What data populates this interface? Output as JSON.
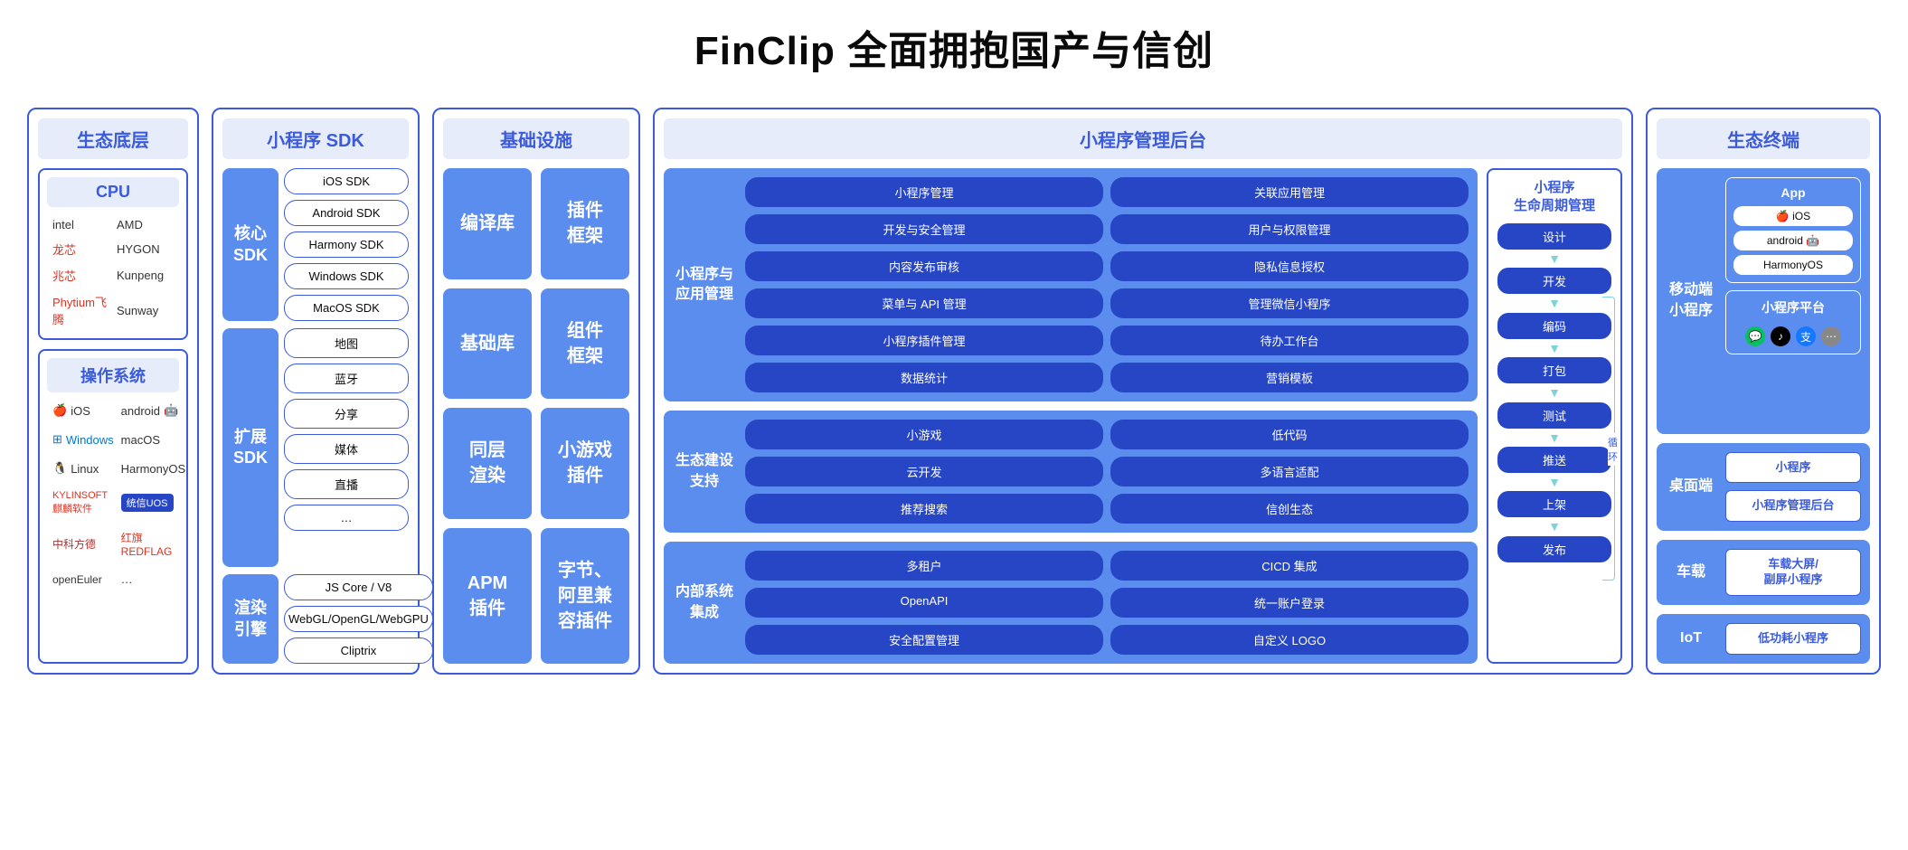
{
  "title": "FinClip 全面拥抱国产与信创",
  "col1": {
    "header": "生态底层",
    "cpu": {
      "title": "CPU",
      "items": [
        "intel",
        "AMD",
        "龙芯",
        "HYGON",
        "兆芯",
        "Kunpeng",
        "Phytium飞腾",
        "Sunway"
      ]
    },
    "os": {
      "title": "操作系统",
      "items": [
        "iOS",
        "android",
        "Windows",
        "macOS",
        "Linux",
        "HarmonyOS",
        "KYLINSOFT 麒麟软件",
        "统信UOS",
        "中科方德",
        "红旗 REDFLAG",
        "openEuler",
        "…"
      ]
    }
  },
  "col2": {
    "header": "小程序 SDK",
    "core": {
      "label": "核心\nSDK",
      "items": [
        "iOS SDK",
        "Android SDK",
        "Harmony SDK",
        "Windows SDK",
        "MacOS SDK"
      ]
    },
    "ext": {
      "label": "扩展\nSDK",
      "items": [
        "地图",
        "蓝牙",
        "分享",
        "媒体",
        "直播",
        "…"
      ]
    },
    "render": {
      "label": "渲染\n引擎",
      "items": [
        "JS Core / V8",
        "WebGL/OpenGL/WebGPU",
        "Cliptrix"
      ]
    }
  },
  "col3": {
    "header": "基础设施",
    "boxes": [
      "编译库",
      "插件\n框架",
      "基础库",
      "组件\n框架",
      "同层\n渲染",
      "小游戏\n插件",
      "APM\n插件",
      "字节、\n阿里兼\n容插件"
    ]
  },
  "col4": {
    "header": "小程序管理后台",
    "s1": {
      "label": "小程序与\n应用管理",
      "items": [
        "小程序管理",
        "关联应用管理",
        "开发与安全管理",
        "用户与权限管理",
        "内容发布审核",
        "隐私信息授权",
        "菜单与 API 管理",
        "管理微信小程序",
        "小程序插件管理",
        "待办工作台",
        "数据统计",
        "营销模板"
      ]
    },
    "s2": {
      "label": "生态建设\n支持",
      "items": [
        "小游戏",
        "低代码",
        "云开发",
        "多语言适配",
        "推荐搜索",
        "信创生态"
      ]
    },
    "s3": {
      "label": "内部系统\n集成",
      "items": [
        "多租户",
        "CICD 集成",
        "OpenAPI",
        "统一账户登录",
        "安全配置管理",
        "自定义 LOGO"
      ]
    },
    "lifecycle": {
      "title": "小程序\n生命周期管理",
      "steps": [
        "设计",
        "开发",
        "编码",
        "打包",
        "测试",
        "推送",
        "上架",
        "发布"
      ],
      "loop": "循\n环"
    }
  },
  "col5": {
    "header": "生态终端",
    "mobile": {
      "label": "移动端\n小程序",
      "app_title": "App",
      "apps": [
        "🍎 iOS",
        "android 🤖",
        "HarmonyOS"
      ],
      "platform_title": "小程序平台"
    },
    "desktop": {
      "label": "桌面端",
      "items": [
        "小程序",
        "小程序管理后台"
      ]
    },
    "vehicle": {
      "label": "车载",
      "items": [
        "车载大屏/\n副屏小程序"
      ]
    },
    "iot": {
      "label": "IoT",
      "items": [
        "低功耗小程序"
      ]
    }
  }
}
